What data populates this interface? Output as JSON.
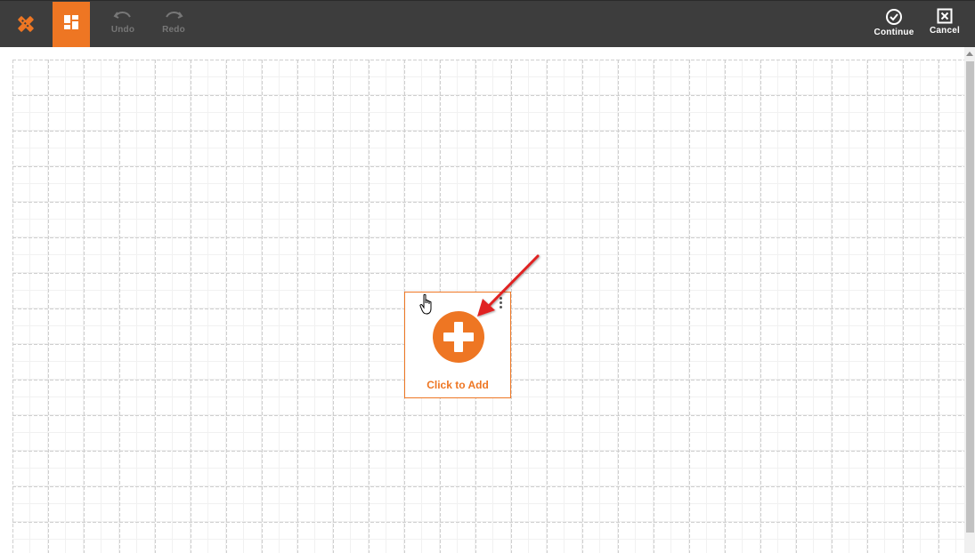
{
  "toolbar": {
    "undo_label": "Undo",
    "redo_label": "Redo",
    "continue_label": "Continue",
    "cancel_label": "Cancel"
  },
  "widget": {
    "label": "Click to Add"
  },
  "colors": {
    "toolbar_bg": "#3d3d3d",
    "accent": "#ee7623",
    "annotation_arrow": "#e02020"
  },
  "icons": {
    "logo": "tools-icon",
    "layout": "layout-icon",
    "undo": "undo-icon",
    "redo": "redo-icon",
    "continue": "check-circle-icon",
    "cancel": "close-square-icon",
    "add": "plus-circle-icon",
    "menu": "kebab-menu-icon"
  }
}
